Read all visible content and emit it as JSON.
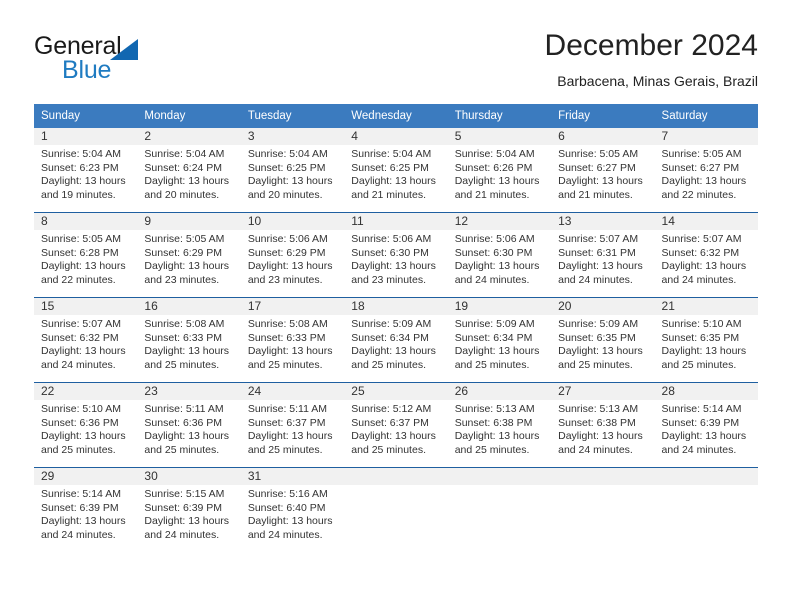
{
  "brand": {
    "name_part1": "General",
    "name_part2": "Blue",
    "triangle_color": "#1167b1",
    "blue_color": "#1f7bc1"
  },
  "header": {
    "title": "December 2024",
    "subtitle": "Barbacena, Minas Gerais, Brazil"
  },
  "colors": {
    "header_row_bg": "#3b7bbf",
    "row_divider": "#1f5fa0",
    "daynum_band_bg": "#f1f1f1",
    "text": "#333333"
  },
  "weekdays": [
    "Sunday",
    "Monday",
    "Tuesday",
    "Wednesday",
    "Thursday",
    "Friday",
    "Saturday"
  ],
  "labels": {
    "sunrise_prefix": "Sunrise:",
    "sunset_prefix": "Sunset:",
    "daylight_prefix": "Daylight:"
  },
  "weeks": [
    [
      {
        "day": "1",
        "sunrise": "Sunrise: 5:04 AM",
        "sunset": "Sunset: 6:23 PM",
        "daylight1": "Daylight: 13 hours",
        "daylight2": "and 19 minutes."
      },
      {
        "day": "2",
        "sunrise": "Sunrise: 5:04 AM",
        "sunset": "Sunset: 6:24 PM",
        "daylight1": "Daylight: 13 hours",
        "daylight2": "and 20 minutes."
      },
      {
        "day": "3",
        "sunrise": "Sunrise: 5:04 AM",
        "sunset": "Sunset: 6:25 PM",
        "daylight1": "Daylight: 13 hours",
        "daylight2": "and 20 minutes."
      },
      {
        "day": "4",
        "sunrise": "Sunrise: 5:04 AM",
        "sunset": "Sunset: 6:25 PM",
        "daylight1": "Daylight: 13 hours",
        "daylight2": "and 21 minutes."
      },
      {
        "day": "5",
        "sunrise": "Sunrise: 5:04 AM",
        "sunset": "Sunset: 6:26 PM",
        "daylight1": "Daylight: 13 hours",
        "daylight2": "and 21 minutes."
      },
      {
        "day": "6",
        "sunrise": "Sunrise: 5:05 AM",
        "sunset": "Sunset: 6:27 PM",
        "daylight1": "Daylight: 13 hours",
        "daylight2": "and 21 minutes."
      },
      {
        "day": "7",
        "sunrise": "Sunrise: 5:05 AM",
        "sunset": "Sunset: 6:27 PM",
        "daylight1": "Daylight: 13 hours",
        "daylight2": "and 22 minutes."
      }
    ],
    [
      {
        "day": "8",
        "sunrise": "Sunrise: 5:05 AM",
        "sunset": "Sunset: 6:28 PM",
        "daylight1": "Daylight: 13 hours",
        "daylight2": "and 22 minutes."
      },
      {
        "day": "9",
        "sunrise": "Sunrise: 5:05 AM",
        "sunset": "Sunset: 6:29 PM",
        "daylight1": "Daylight: 13 hours",
        "daylight2": "and 23 minutes."
      },
      {
        "day": "10",
        "sunrise": "Sunrise: 5:06 AM",
        "sunset": "Sunset: 6:29 PM",
        "daylight1": "Daylight: 13 hours",
        "daylight2": "and 23 minutes."
      },
      {
        "day": "11",
        "sunrise": "Sunrise: 5:06 AM",
        "sunset": "Sunset: 6:30 PM",
        "daylight1": "Daylight: 13 hours",
        "daylight2": "and 23 minutes."
      },
      {
        "day": "12",
        "sunrise": "Sunrise: 5:06 AM",
        "sunset": "Sunset: 6:30 PM",
        "daylight1": "Daylight: 13 hours",
        "daylight2": "and 24 minutes."
      },
      {
        "day": "13",
        "sunrise": "Sunrise: 5:07 AM",
        "sunset": "Sunset: 6:31 PM",
        "daylight1": "Daylight: 13 hours",
        "daylight2": "and 24 minutes."
      },
      {
        "day": "14",
        "sunrise": "Sunrise: 5:07 AM",
        "sunset": "Sunset: 6:32 PM",
        "daylight1": "Daylight: 13 hours",
        "daylight2": "and 24 minutes."
      }
    ],
    [
      {
        "day": "15",
        "sunrise": "Sunrise: 5:07 AM",
        "sunset": "Sunset: 6:32 PM",
        "daylight1": "Daylight: 13 hours",
        "daylight2": "and 24 minutes."
      },
      {
        "day": "16",
        "sunrise": "Sunrise: 5:08 AM",
        "sunset": "Sunset: 6:33 PM",
        "daylight1": "Daylight: 13 hours",
        "daylight2": "and 25 minutes."
      },
      {
        "day": "17",
        "sunrise": "Sunrise: 5:08 AM",
        "sunset": "Sunset: 6:33 PM",
        "daylight1": "Daylight: 13 hours",
        "daylight2": "and 25 minutes."
      },
      {
        "day": "18",
        "sunrise": "Sunrise: 5:09 AM",
        "sunset": "Sunset: 6:34 PM",
        "daylight1": "Daylight: 13 hours",
        "daylight2": "and 25 minutes."
      },
      {
        "day": "19",
        "sunrise": "Sunrise: 5:09 AM",
        "sunset": "Sunset: 6:34 PM",
        "daylight1": "Daylight: 13 hours",
        "daylight2": "and 25 minutes."
      },
      {
        "day": "20",
        "sunrise": "Sunrise: 5:09 AM",
        "sunset": "Sunset: 6:35 PM",
        "daylight1": "Daylight: 13 hours",
        "daylight2": "and 25 minutes."
      },
      {
        "day": "21",
        "sunrise": "Sunrise: 5:10 AM",
        "sunset": "Sunset: 6:35 PM",
        "daylight1": "Daylight: 13 hours",
        "daylight2": "and 25 minutes."
      }
    ],
    [
      {
        "day": "22",
        "sunrise": "Sunrise: 5:10 AM",
        "sunset": "Sunset: 6:36 PM",
        "daylight1": "Daylight: 13 hours",
        "daylight2": "and 25 minutes."
      },
      {
        "day": "23",
        "sunrise": "Sunrise: 5:11 AM",
        "sunset": "Sunset: 6:36 PM",
        "daylight1": "Daylight: 13 hours",
        "daylight2": "and 25 minutes."
      },
      {
        "day": "24",
        "sunrise": "Sunrise: 5:11 AM",
        "sunset": "Sunset: 6:37 PM",
        "daylight1": "Daylight: 13 hours",
        "daylight2": "and 25 minutes."
      },
      {
        "day": "25",
        "sunrise": "Sunrise: 5:12 AM",
        "sunset": "Sunset: 6:37 PM",
        "daylight1": "Daylight: 13 hours",
        "daylight2": "and 25 minutes."
      },
      {
        "day": "26",
        "sunrise": "Sunrise: 5:13 AM",
        "sunset": "Sunset: 6:38 PM",
        "daylight1": "Daylight: 13 hours",
        "daylight2": "and 25 minutes."
      },
      {
        "day": "27",
        "sunrise": "Sunrise: 5:13 AM",
        "sunset": "Sunset: 6:38 PM",
        "daylight1": "Daylight: 13 hours",
        "daylight2": "and 24 minutes."
      },
      {
        "day": "28",
        "sunrise": "Sunrise: 5:14 AM",
        "sunset": "Sunset: 6:39 PM",
        "daylight1": "Daylight: 13 hours",
        "daylight2": "and 24 minutes."
      }
    ],
    [
      {
        "day": "29",
        "sunrise": "Sunrise: 5:14 AM",
        "sunset": "Sunset: 6:39 PM",
        "daylight1": "Daylight: 13 hours",
        "daylight2": "and 24 minutes."
      },
      {
        "day": "30",
        "sunrise": "Sunrise: 5:15 AM",
        "sunset": "Sunset: 6:39 PM",
        "daylight1": "Daylight: 13 hours",
        "daylight2": "and 24 minutes."
      },
      {
        "day": "31",
        "sunrise": "Sunrise: 5:16 AM",
        "sunset": "Sunset: 6:40 PM",
        "daylight1": "Daylight: 13 hours",
        "daylight2": "and 24 minutes."
      },
      {
        "day": "",
        "sunrise": "",
        "sunset": "",
        "daylight1": "",
        "daylight2": ""
      },
      {
        "day": "",
        "sunrise": "",
        "sunset": "",
        "daylight1": "",
        "daylight2": ""
      },
      {
        "day": "",
        "sunrise": "",
        "sunset": "",
        "daylight1": "",
        "daylight2": ""
      },
      {
        "day": "",
        "sunrise": "",
        "sunset": "",
        "daylight1": "",
        "daylight2": ""
      }
    ]
  ]
}
